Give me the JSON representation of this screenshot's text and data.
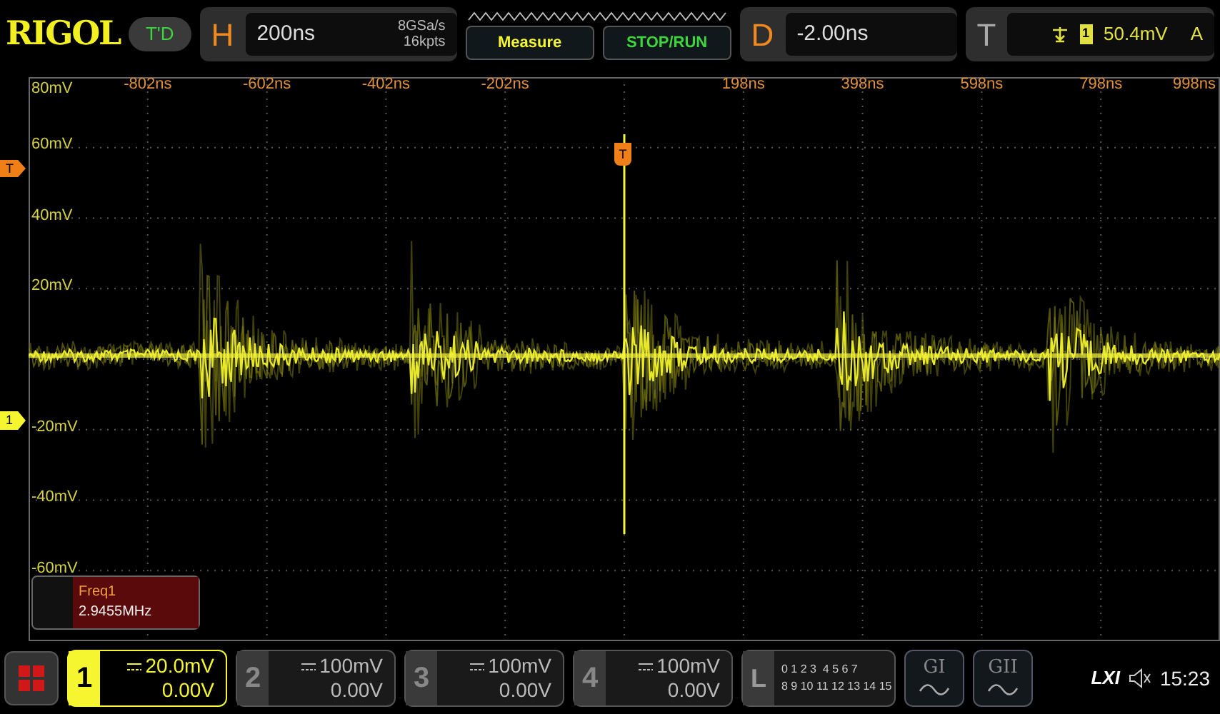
{
  "brand": "RIGOL",
  "mode_badge": "T'D",
  "horizontal": {
    "label": "H",
    "timebase": "200ns",
    "sample_rate": "8GSa/s",
    "memory_depth": "16kpts"
  },
  "buttons": [
    {
      "label": "Measure",
      "kind": "measure"
    },
    {
      "label": "STOP/RUN",
      "kind": "run"
    }
  ],
  "delay": {
    "label": "D",
    "value": "-2.00ns"
  },
  "trigger": {
    "label": "T",
    "source": "1",
    "level": "50.4mV",
    "mode": "A"
  },
  "time_axis": [
    "-802ns",
    "-602ns",
    "-402ns",
    "-202ns",
    "198ns",
    "398ns",
    "598ns",
    "798ns",
    "998ns"
  ],
  "volt_axis": [
    "80mV",
    "60mV",
    "40mV",
    "20mV",
    "-20mV",
    "-40mV",
    "-60mV"
  ],
  "markers": [
    {
      "label": "T",
      "kind": "trigger_level"
    },
    {
      "label": "1",
      "kind": "channel"
    },
    {
      "label": "T",
      "kind": "trigger_position"
    }
  ],
  "measurement": {
    "name": "Freq1",
    "value": "2.9455MHz"
  },
  "channels": [
    {
      "number": "1",
      "scale": "20.0mV",
      "offset": "0.00V",
      "on": true
    },
    {
      "number": "2",
      "scale": "100mV",
      "offset": "0.00V",
      "on": false
    },
    {
      "number": "3",
      "scale": "100mV",
      "offset": "0.00V",
      "on": false
    },
    {
      "number": "4",
      "scale": "100mV",
      "offset": "0.00V",
      "on": false
    }
  ],
  "logic": {
    "label": "L",
    "rows": [
      "0 1 2 3  4 5 6 7",
      "8 9 10 11 12 13 14 15"
    ]
  },
  "generators": [
    {
      "label": "GI"
    },
    {
      "label": "GII"
    }
  ],
  "status": {
    "lxi": "LXI",
    "time": "15:23"
  }
}
